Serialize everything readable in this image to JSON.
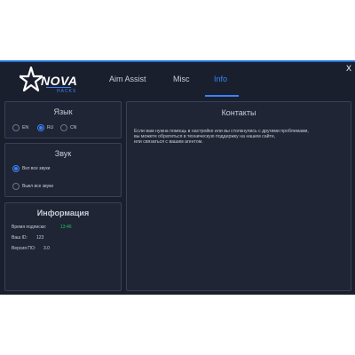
{
  "window": {
    "close_label": "X"
  },
  "logo": {
    "name": "NOVA",
    "sub": "HACKS"
  },
  "tabs": [
    {
      "label": "Aim Assist",
      "active": false
    },
    {
      "label": "Misc",
      "active": false
    },
    {
      "label": "Info",
      "active": true
    }
  ],
  "language": {
    "title": "Язык",
    "options": [
      {
        "label": "EN",
        "checked": false
      },
      {
        "label": "RU",
        "checked": true
      },
      {
        "label": "CN",
        "checked": false
      }
    ]
  },
  "sound": {
    "title": "Звук",
    "options": [
      {
        "label": "Вкл все звуки",
        "checked": true
      },
      {
        "label": "Выкл все звуки",
        "checked": false
      }
    ]
  },
  "information": {
    "title": "Информация",
    "rows": [
      {
        "label": "Время подписки:",
        "value": "13:46"
      },
      {
        "label": "Ваш ID:",
        "value": "123"
      },
      {
        "label": "Версия ПО:",
        "value": "3.0"
      }
    ]
  },
  "contacts": {
    "title": "Контакты",
    "lines": [
      "Если вам нужна помощь в настройке или вы столкнулись с другими проблемами,",
      "вы можете обратиться в техническую поддержку на нашем сайте,",
      "или связаться с вашим агентом."
    ]
  },
  "colors": {
    "accent": "#3b82f6",
    "background": "#1a1f2e",
    "panel": "#1f2535",
    "timer": "#22c55e"
  }
}
